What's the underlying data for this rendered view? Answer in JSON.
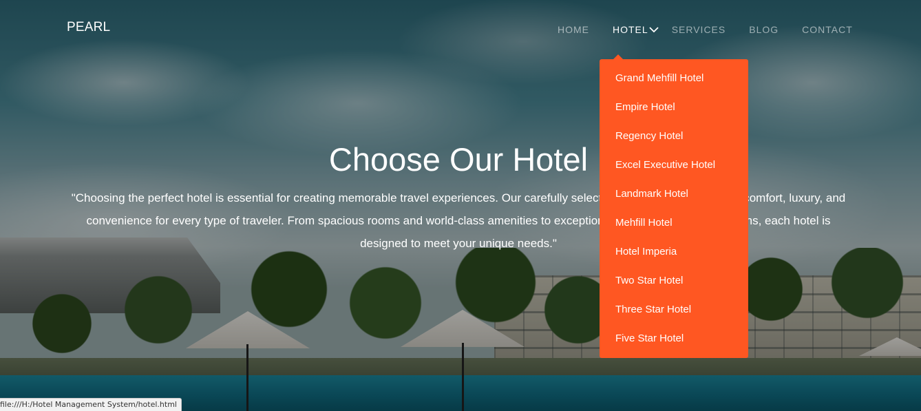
{
  "brand": {
    "name": "PEARL"
  },
  "nav": {
    "home": "HOME",
    "hotel": "HOTEL",
    "services": "SERVICES",
    "blog": "BLOG",
    "contact": "CONTACT"
  },
  "dropdown": {
    "items": [
      "Grand Mehfill Hotel",
      "Empire Hotel",
      "Regency Hotel",
      "Excel Executive Hotel",
      "Landmark Hotel",
      "Mehfill Hotel",
      "Hotel Imperia",
      "Two Star Hotel",
      "Three Star Hotel",
      "Five Star Hotel"
    ]
  },
  "hero": {
    "title": "Choose Our Hotel",
    "text": "\"Choosing the perfect hotel is essential for creating memorable travel experiences. Our carefully selected range of hotels ensures comfort, luxury, and convenience for every type of traveler. From spacious rooms and world-class amenities to exceptional service and prime locations, each hotel is designed to meet your unique needs.\""
  },
  "status_bar": {
    "url": "file:///H:/Hotel Management System/hotel.html"
  },
  "colors": {
    "accent": "#ff5722",
    "nav_active": "#ffffff",
    "nav_inactive": "rgba(255,255,255,0.55)"
  }
}
